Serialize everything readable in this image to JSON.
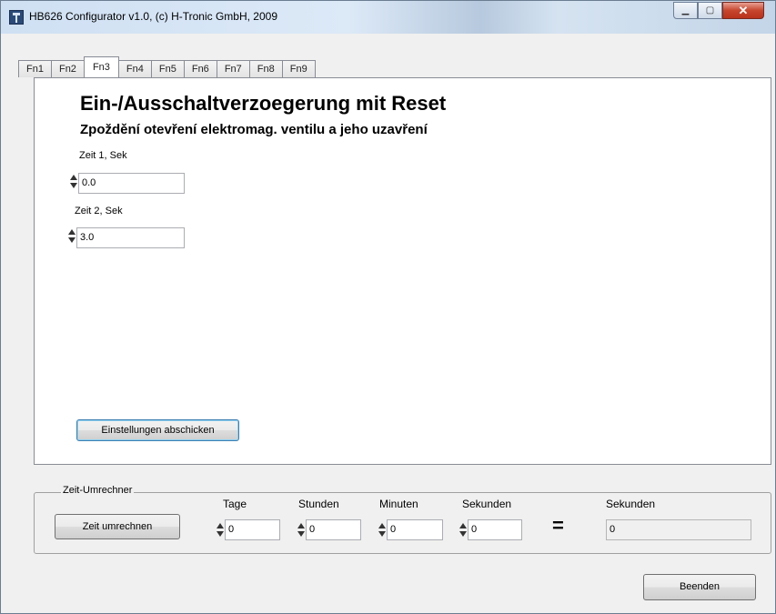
{
  "window": {
    "title": "HB626 Configurator v1.0, (c) H-Tronic GmbH, 2009"
  },
  "tabs": [
    {
      "label": "Fn1"
    },
    {
      "label": "Fn2"
    },
    {
      "label": "Fn3"
    },
    {
      "label": "Fn4"
    },
    {
      "label": "Fn5"
    },
    {
      "label": "Fn6"
    },
    {
      "label": "Fn7"
    },
    {
      "label": "Fn8"
    },
    {
      "label": "Fn9"
    }
  ],
  "active_tab": "Fn3",
  "panel": {
    "heading": "Ein-/Ausschaltverzoegerung mit Reset",
    "subheading": "Zpoždění otevření elektromag. ventilu a jeho uzavření",
    "zeit1": {
      "label": "Zeit 1, Sek",
      "value": "0.0"
    },
    "zeit2": {
      "label": "Zeit 2, Sek",
      "value": "3.0"
    },
    "submit_label": "Einstellungen abschicken"
  },
  "converter": {
    "legend": "Zeit-Umrechner",
    "button_label": "Zeit umrechnen",
    "tage": {
      "label": "Tage",
      "value": "0"
    },
    "stunden": {
      "label": "Stunden",
      "value": "0"
    },
    "minuten": {
      "label": "Minuten",
      "value": "0"
    },
    "sekunden": {
      "label": "Sekunden",
      "value": "0"
    },
    "equals": "=",
    "result": {
      "label": "Sekunden",
      "value": "0"
    }
  },
  "footer": {
    "exit_label": "Beenden"
  },
  "colors": {
    "titlebar": "#cfe0f3",
    "close_button": "#c7452d",
    "focus_border": "#3c7fb1"
  }
}
